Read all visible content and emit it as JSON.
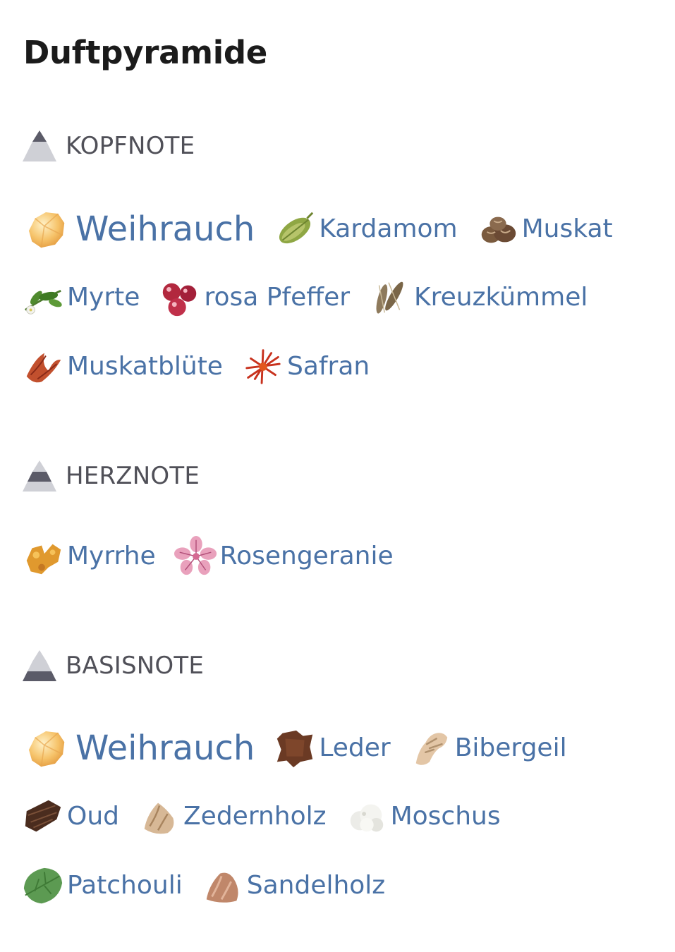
{
  "title": "Duftpyramide",
  "sections": [
    {
      "label": "KOPFNOTE",
      "level": "top",
      "rows": [
        [
          {
            "name": "Weihrauch",
            "icon": "frankincense-icon",
            "prominent": true
          },
          {
            "name": "Kardamom",
            "icon": "cardamom-icon"
          },
          {
            "name": "Muskat",
            "icon": "nutmeg-icon"
          }
        ],
        [
          {
            "name": "Myrte",
            "icon": "myrtle-icon"
          },
          {
            "name": "rosa Pfeffer",
            "icon": "pink-pepper-icon"
          },
          {
            "name": "Kreuzkümmel",
            "icon": "cumin-icon"
          }
        ],
        [
          {
            "name": "Muskatblüte",
            "icon": "mace-icon"
          },
          {
            "name": "Safran",
            "icon": "saffron-icon"
          }
        ]
      ]
    },
    {
      "label": "HERZNOTE",
      "level": "middle",
      "rows": [
        [
          {
            "name": "Myrrhe",
            "icon": "myrrh-icon"
          },
          {
            "name": "Rosengeranie",
            "icon": "rose-geranium-icon"
          }
        ]
      ]
    },
    {
      "label": "BASISNOTE",
      "level": "base",
      "rows": [
        [
          {
            "name": "Weihrauch",
            "icon": "frankincense-icon",
            "prominent": true
          },
          {
            "name": "Leder",
            "icon": "leather-icon"
          },
          {
            "name": "Bibergeil",
            "icon": "castoreum-icon"
          }
        ],
        [
          {
            "name": "Oud",
            "icon": "oud-icon"
          },
          {
            "name": "Zedernholz",
            "icon": "cedarwood-icon"
          },
          {
            "name": "Moschus",
            "icon": "musk-icon"
          }
        ],
        [
          {
            "name": "Patchouli",
            "icon": "patchouli-icon"
          },
          {
            "name": "Sandelholz",
            "icon": "sandalwood-icon"
          }
        ]
      ]
    }
  ],
  "colors": {
    "note_text": "#4a72a6",
    "section_label": "#505058",
    "pyramid_light": "#cfd0d6",
    "pyramid_dark": "#5b5b68"
  }
}
